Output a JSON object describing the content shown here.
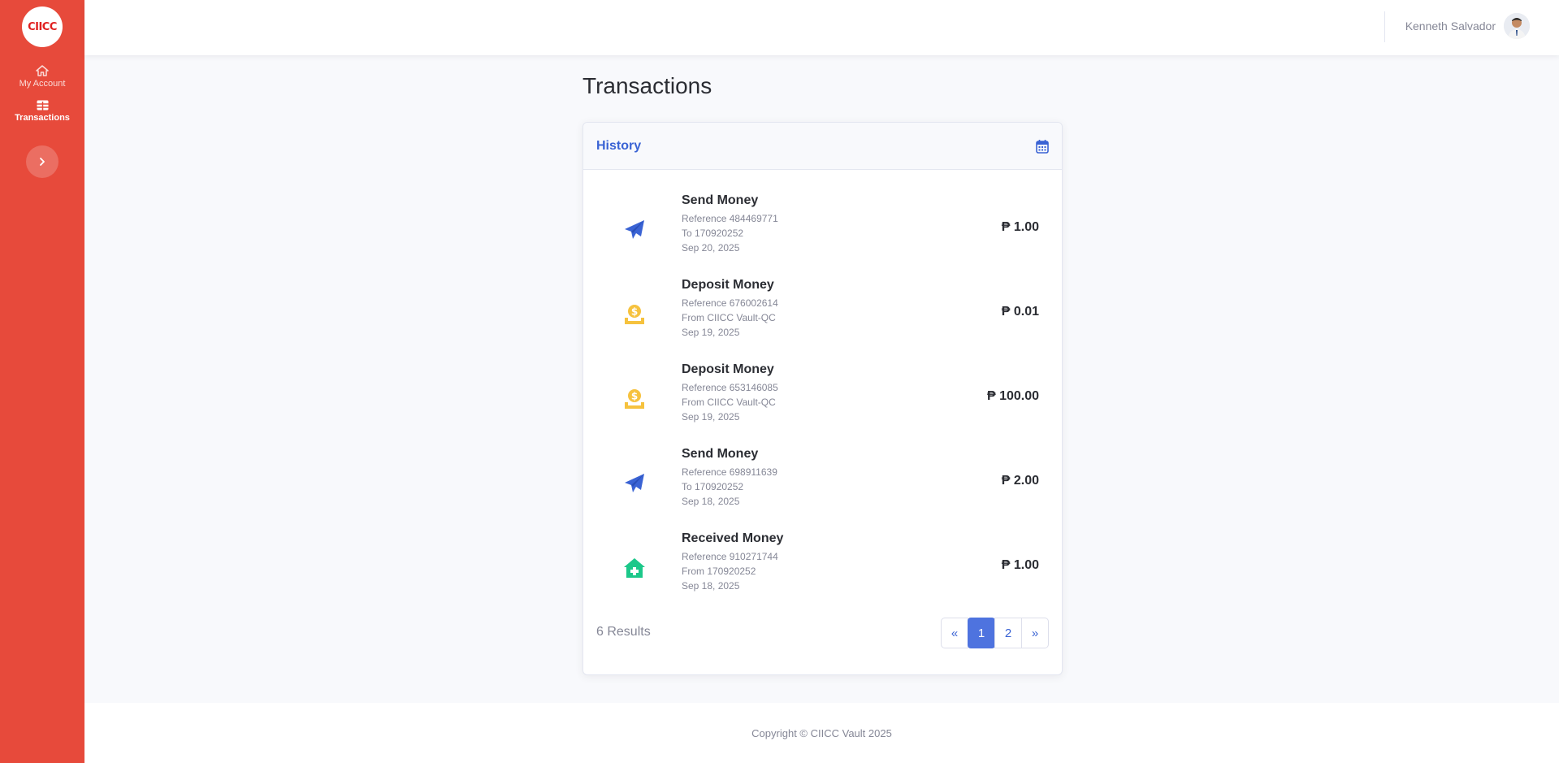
{
  "brand": {
    "name": "CIICC"
  },
  "sidebar": {
    "items": [
      {
        "label": "My Account",
        "icon": "home-icon"
      },
      {
        "label": "Transactions",
        "icon": "table-icon"
      }
    ]
  },
  "header": {
    "user_name": "Kenneth Salvador"
  },
  "page": {
    "title": "Transactions"
  },
  "card": {
    "title": "History"
  },
  "transactions": [
    {
      "type": "Send Money",
      "reference": "Reference 484469771",
      "party": "To 170920252",
      "date": "Sep 20, 2025",
      "amount": "1.00",
      "icon": "paper-plane-icon"
    },
    {
      "type": "Deposit Money",
      "reference": "Reference 676002614",
      "party": "From CIICC Vault-QC",
      "date": "Sep 19, 2025",
      "amount": "0.01",
      "icon": "coin-deposit-icon"
    },
    {
      "type": "Deposit Money",
      "reference": "Reference 653146085",
      "party": "From CIICC Vault-QC",
      "date": "Sep 19, 2025",
      "amount": "100.00",
      "icon": "coin-deposit-icon"
    },
    {
      "type": "Send Money",
      "reference": "Reference 698911639",
      "party": "To 170920252",
      "date": "Sep 18, 2025",
      "amount": "2.00",
      "icon": "paper-plane-icon"
    },
    {
      "type": "Received Money",
      "reference": "Reference 910271744",
      "party": "From 170920252",
      "date": "Sep 18, 2025",
      "amount": "1.00",
      "icon": "house-plus-icon"
    }
  ],
  "currency_symbol": "₱",
  "footer": {
    "results": "6 Results",
    "pages": [
      "«",
      "1",
      "2",
      "»"
    ],
    "active_page": "1"
  },
  "copyright": "Copyright © CIICC Vault 2025",
  "colors": {
    "sidebar": "#e74a3b",
    "accent": "#4e73df",
    "send_icon": "#3a63d4",
    "deposit_icon": "#f6c23e",
    "receive_icon": "#1cc88a"
  }
}
